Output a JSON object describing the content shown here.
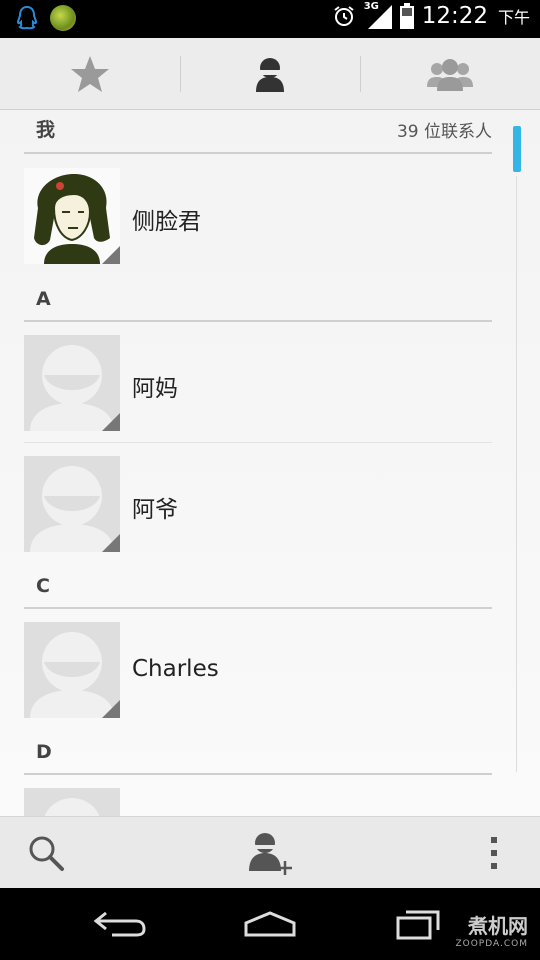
{
  "status_bar": {
    "time": "12:22",
    "ampm": "下午",
    "network": "3G",
    "icons": [
      "qq-icon",
      "app-icon",
      "alarm-icon",
      "signal-icon",
      "battery-icon"
    ]
  },
  "tabs": [
    {
      "name": "favorites",
      "icon": "star-icon",
      "selected": false
    },
    {
      "name": "contacts",
      "icon": "person-icon",
      "selected": true
    },
    {
      "name": "groups",
      "icon": "group-icon",
      "selected": false
    }
  ],
  "me_section": {
    "label": "我",
    "count": "39 位联系人"
  },
  "contacts": [
    {
      "name": "侧脸君",
      "photo": true
    },
    {
      "section": "A"
    },
    {
      "name": "阿妈"
    },
    {
      "name": "阿爷"
    },
    {
      "section": "C"
    },
    {
      "name": "Charles"
    },
    {
      "section": "D"
    }
  ],
  "sections": {
    "a": "A",
    "c": "C",
    "d": "D"
  },
  "rows": {
    "me_name": "侧脸君",
    "ama": "阿妈",
    "aye": "阿爷",
    "charles": "Charles"
  },
  "actions": {
    "search": "search-icon",
    "add": "add-contact-icon",
    "menu": "overflow-menu-icon"
  },
  "watermark": {
    "main": "煮机网",
    "sub": "ZOOPDA.COM"
  },
  "colors": {
    "accent": "#33b5e5",
    "tab_bg": "#ececec",
    "placeholder": "#dedede"
  }
}
